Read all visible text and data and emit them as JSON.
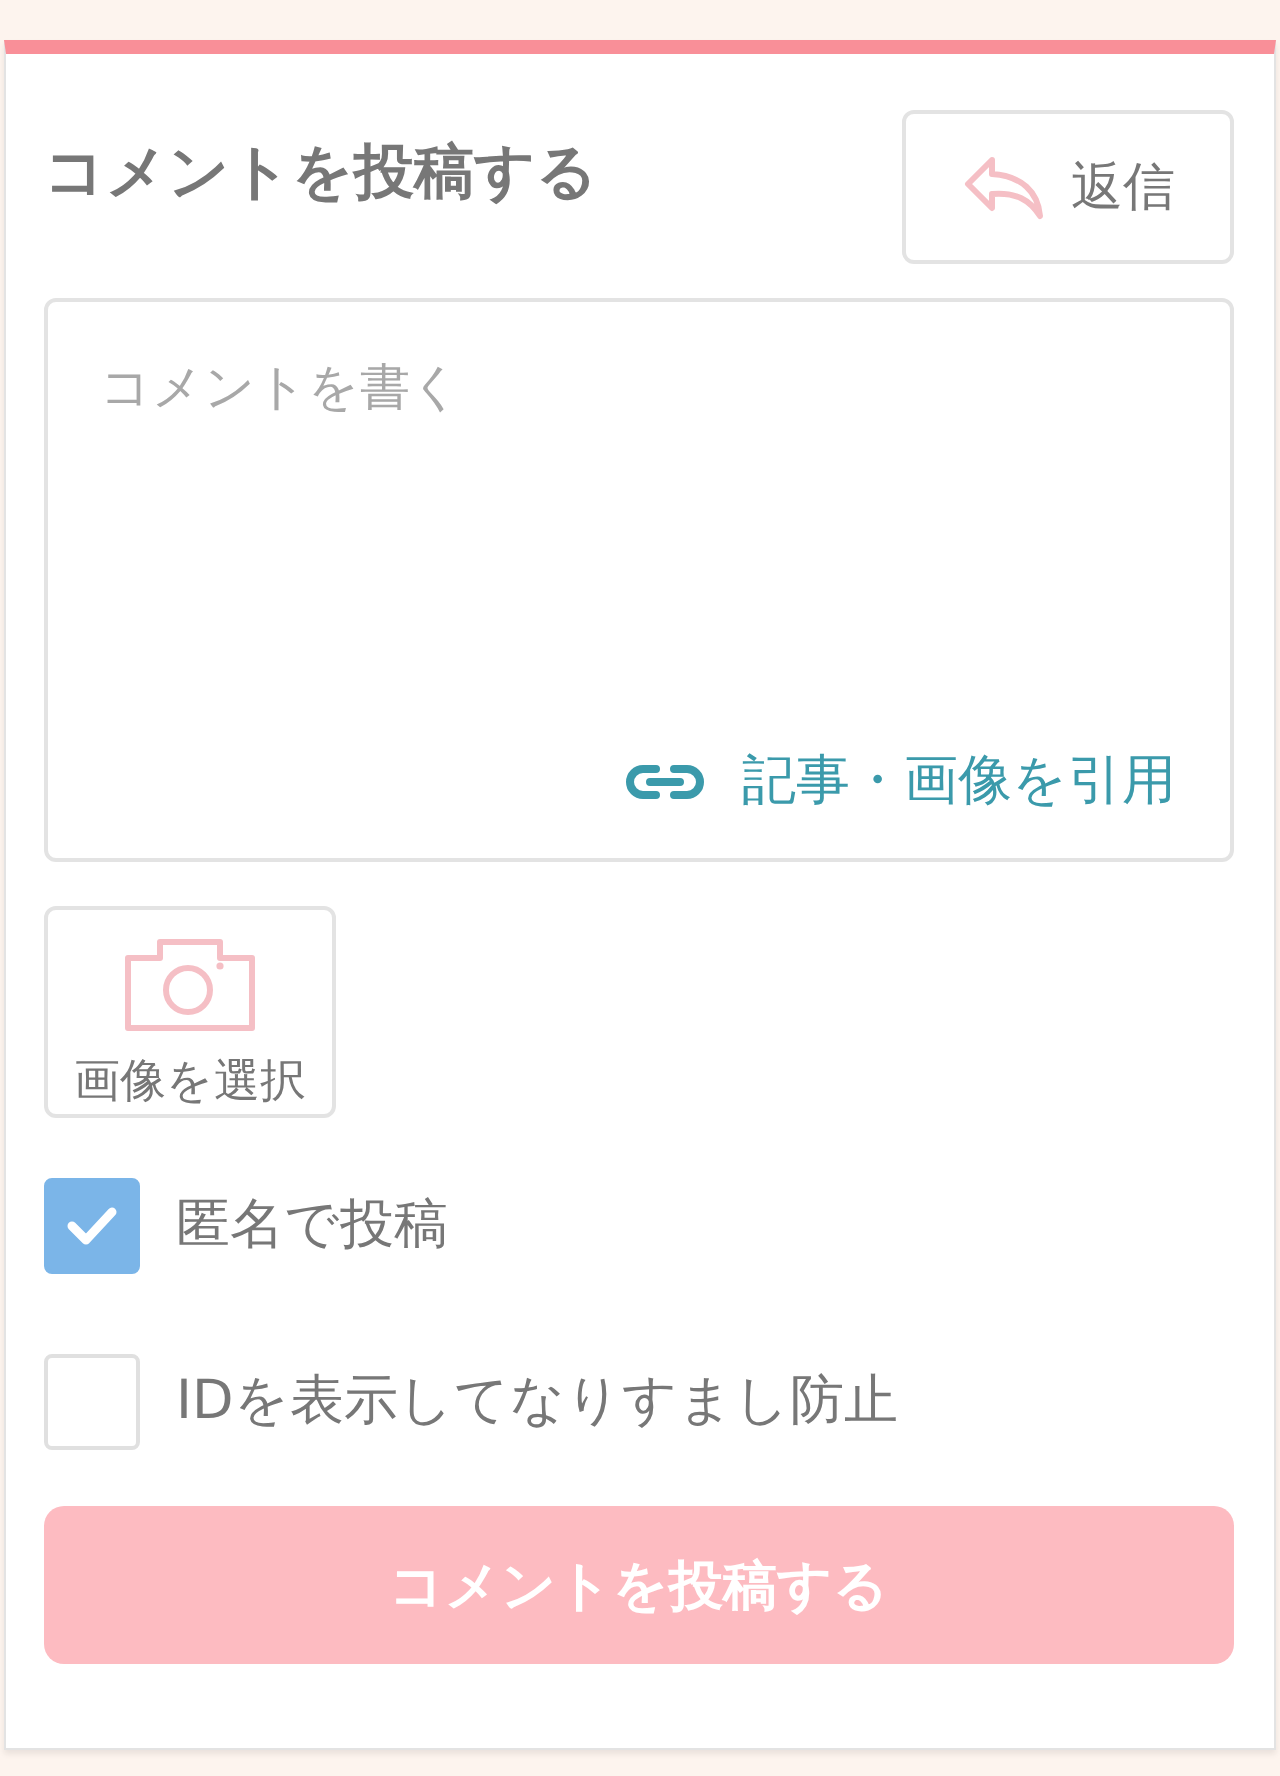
{
  "form": {
    "title": "コメントを投稿する",
    "reply_button": {
      "label": "返信"
    },
    "comment_field": {
      "placeholder": "コメントを書く"
    },
    "quote_link": {
      "label": "記事・画像を引用"
    },
    "image_button": {
      "label": "画像を選択"
    },
    "options": [
      {
        "label": "匿名で投稿",
        "checked": true
      },
      {
        "label": "IDを表示してなりすまし防止",
        "checked": false
      }
    ],
    "submit_button": {
      "label": "コメントを投稿する"
    }
  }
}
